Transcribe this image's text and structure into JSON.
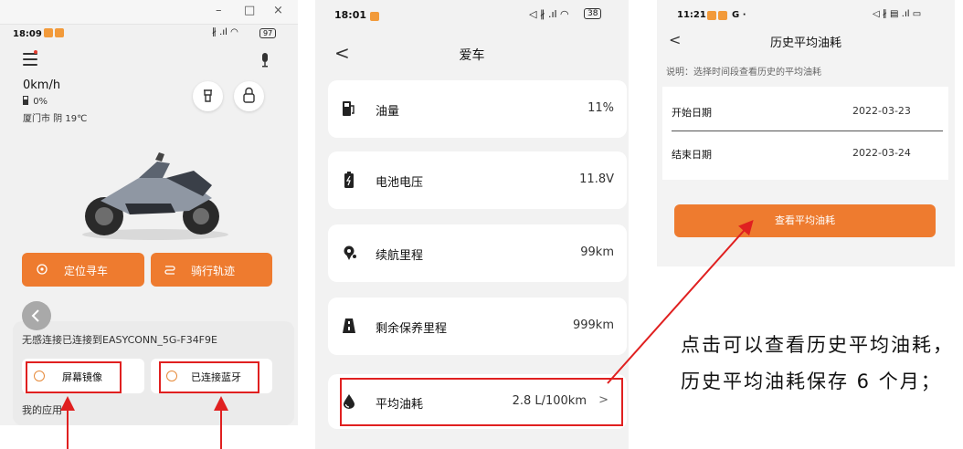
{
  "screen1": {
    "window_controls": [
      "–",
      "□",
      "×"
    ],
    "status_time": "18:09",
    "status_battery": "97",
    "speed": "0km/h",
    "fuel": "0%",
    "weather": "厦门市 阴 19℃",
    "btn_locate": "定位寻车",
    "btn_track": "骑行轨迹",
    "connection_text": "无感连接已连接到EASYCONN_5G-F34F9E",
    "card_mirror": "屏幕镜像",
    "card_bt": "已连接蓝牙",
    "my_apps": "我的应用"
  },
  "screen2": {
    "status_time": "18:01",
    "status_battery": "38",
    "title": "爱车",
    "back_glyph": "<",
    "rows": [
      {
        "label": "油量",
        "value": "11%"
      },
      {
        "label": "电池电压",
        "value": "11.8V"
      },
      {
        "label": "续航里程",
        "value": "99km"
      },
      {
        "label": "剩余保养里程",
        "value": "999km"
      },
      {
        "label": "平均油耗",
        "value": "2.8 L/100km",
        "chevron": ">"
      }
    ]
  },
  "screen3": {
    "status_time": "11:21",
    "status_extra": "G ·",
    "title": "历史平均油耗",
    "back_glyph": "<",
    "description": "说明：选择时间段查看历史的平均油耗",
    "start_label": "开始日期",
    "start_value": "2022-03-23",
    "end_label": "结束日期",
    "end_value": "2022-03-24",
    "button": "查看平均油耗"
  },
  "annotation": {
    "text": "点击可以查看历史平均油耗，历史平均油耗保存 6 个月；"
  },
  "colors": {
    "accent": "#ee7b2f",
    "highlight": "#e02020"
  }
}
